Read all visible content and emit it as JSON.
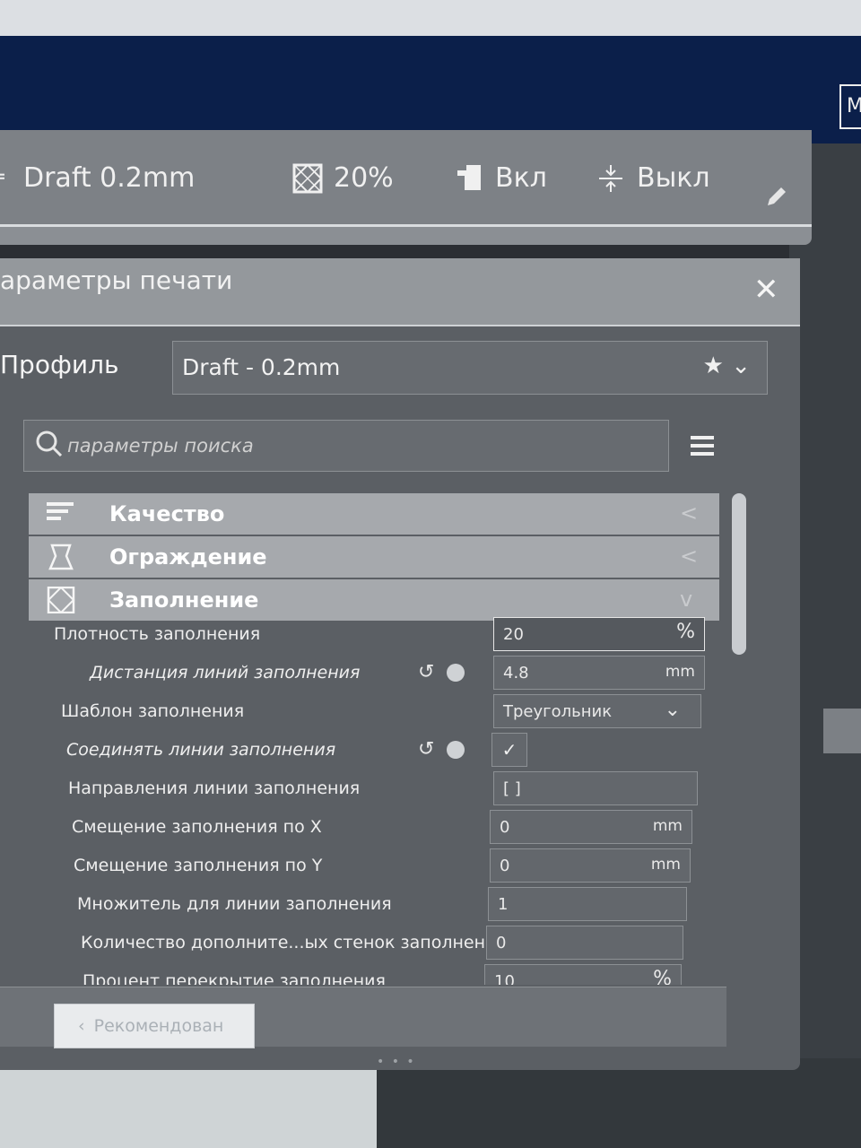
{
  "topbar": {
    "profile": "Draft 0.2mm",
    "infill": "20%",
    "support": "Вкл",
    "adhesion": "Выкл"
  },
  "panel": {
    "title": "араметры печати",
    "profile_label": "Профиль",
    "profile_value": "Draft - 0.2mm",
    "search_placeholder": "параметры поиска"
  },
  "categories": [
    {
      "label": "Качество",
      "icon": "quality-icon",
      "chevron": "<"
    },
    {
      "label": "Ограждение",
      "icon": "walls-icon",
      "chevron": "<"
    },
    {
      "label": "Заполнение",
      "icon": "infill-icon",
      "chevron": "v"
    }
  ],
  "settings": [
    {
      "label": "Плотность заполнения",
      "value": "20",
      "unit": "%"
    },
    {
      "label": "Дистанция линий заполнения",
      "value": "4.8",
      "unit": "mm"
    },
    {
      "label": "Шаблон заполнения",
      "value": "Треугольник",
      "unit": ""
    },
    {
      "label": "Соединять линии заполнения",
      "value": "✓",
      "unit": ""
    },
    {
      "label": "Направления линии заполнения",
      "value": "[ ]",
      "unit": ""
    },
    {
      "label": "Смещение заполнения по X",
      "value": "0",
      "unit": "mm"
    },
    {
      "label": "Смещение заполнения по Y",
      "value": "0",
      "unit": "mm"
    },
    {
      "label": "Множитель для линии заполнения",
      "value": "1",
      "unit": ""
    },
    {
      "label": "Количество дополните...ых стенок заполнения",
      "value": "0",
      "unit": ""
    },
    {
      "label": "Процент перекрытие заполнения",
      "value": "10",
      "unit": "%"
    }
  ],
  "footer": {
    "recommended_label": "Рекомендован"
  },
  "colors": {
    "panel_bg": "#5b5f64",
    "category_bg": "#a6a9ad",
    "header_bg": "#94989c"
  }
}
